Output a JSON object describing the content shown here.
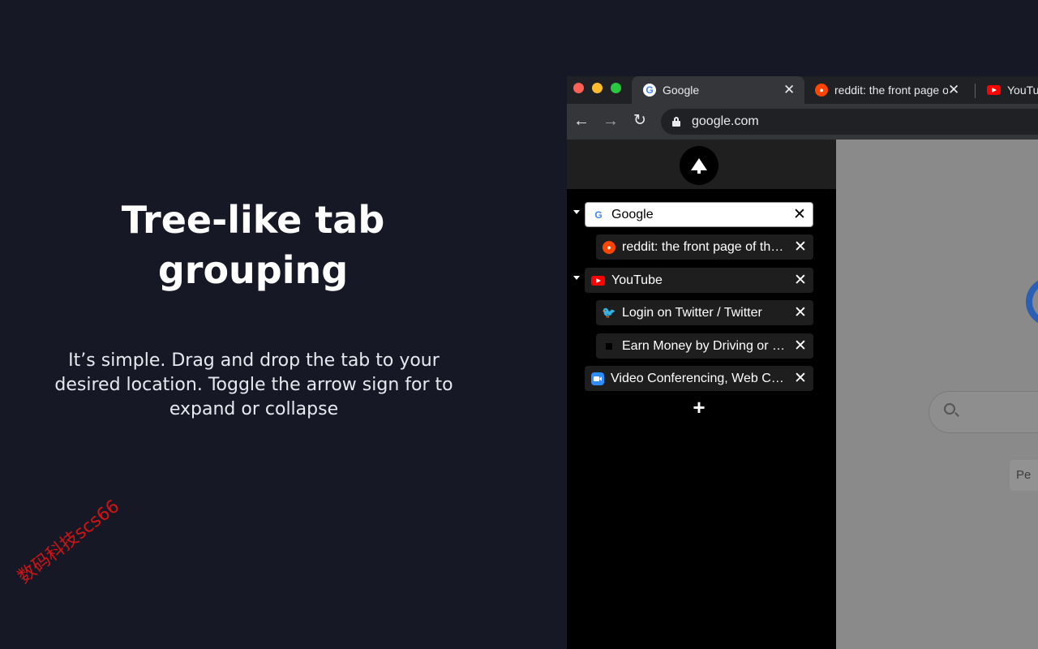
{
  "promo": {
    "title": "Tree-like tab grouping",
    "description": "It’s simple. Drag and drop the tab to your desired location.  Toggle the arrow sign for to expand or collapse"
  },
  "watermark": "数码科技scs66",
  "browser": {
    "tabs": [
      {
        "label": "Google",
        "icon": "google-icon",
        "active": true
      },
      {
        "label": "reddit: the front page of the internet",
        "icon": "reddit-icon",
        "active": false
      },
      {
        "label": "YouTube",
        "icon": "youtube-icon",
        "active": false
      }
    ],
    "address": "google.com",
    "nav_icons": {
      "back": "←",
      "forward": "→",
      "reload": "↻"
    }
  },
  "sidebar": {
    "logo_icon": "tree-icon",
    "rows": [
      {
        "title": "Google",
        "icon": "google-icon",
        "level": 0,
        "expandable": true,
        "selected": true
      },
      {
        "title": "reddit: the front page of the internet",
        "icon": "reddit-icon",
        "level": 1,
        "expandable": false,
        "selected": false
      },
      {
        "title": "YouTube",
        "icon": "youtube-icon",
        "level": 0,
        "expandable": true,
        "selected": false
      },
      {
        "title": "Login on Twitter / Twitter",
        "icon": "twitter-icon",
        "level": 1,
        "expandable": false,
        "selected": false
      },
      {
        "title": "Earn Money by Driving or Get a Ride",
        "icon": "uber-icon",
        "level": 1,
        "expandable": false,
        "selected": false
      },
      {
        "title": "Video Conferencing, Web Conferencing",
        "icon": "zoom-icon",
        "level": 0,
        "expandable": false,
        "selected": false
      }
    ],
    "add_label": "+"
  },
  "page": {
    "button_text": "Pe"
  },
  "colors": {
    "background": "#161826",
    "chrome_dark": "#202124",
    "chrome_toolbar": "#35363a",
    "sidebar": "#000000",
    "accent_red": "#d41414"
  }
}
